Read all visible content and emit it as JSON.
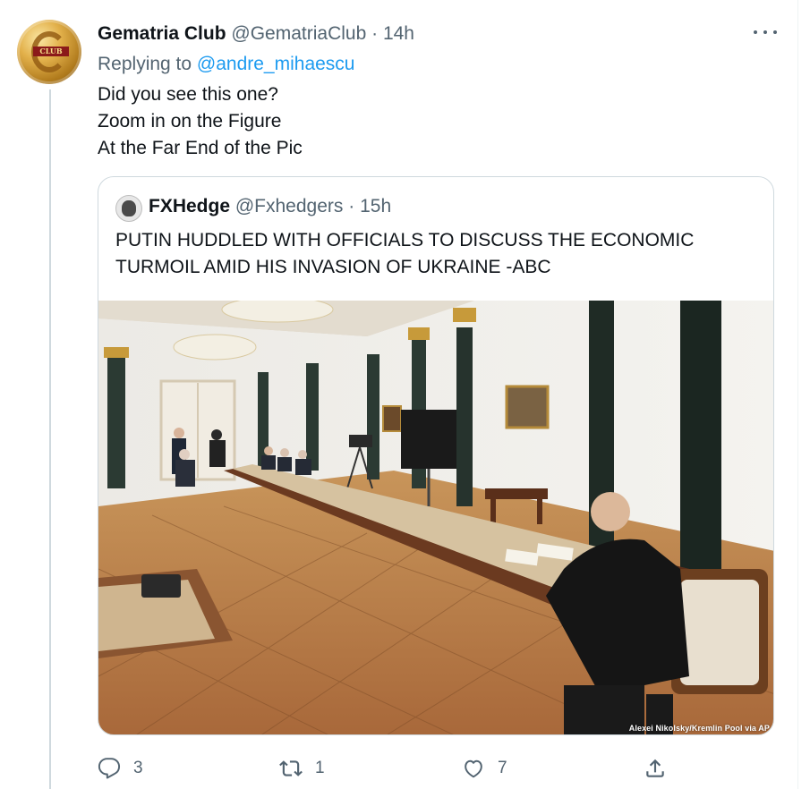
{
  "tweet": {
    "author_name": "Gematria Club",
    "author_handle": "@GematriaClub",
    "separator": "·",
    "time": "14h",
    "avatar_text": "CLUB",
    "replying_prefix": "Replying to",
    "replying_handle": "@andre_mihaescu",
    "lines": [
      "Did you see this one?",
      "Zoom in on the Figure",
      "At the Far End of the Pic"
    ]
  },
  "quoted": {
    "author_name": "FXHedge",
    "author_handle": "@Fxhedgers",
    "separator": "·",
    "time": "15h",
    "lines": [
      "PUTIN HUDDLED WITH OFFICIALS TO DISCUSS THE ECONOMIC",
      "TURMOIL AMID HIS INVASION OF UKRAINE -ABC"
    ],
    "photo_credit": "Alexei Nikolsky/Kremlin Pool via AP"
  },
  "actions": {
    "reply_count": "3",
    "retweet_count": "1",
    "like_count": "7",
    "reply_icon": "reply-icon",
    "retweet_icon": "retweet-icon",
    "like_icon": "like-icon",
    "share_icon": "share-icon"
  },
  "colors": {
    "link": "#1d9bf0",
    "muted": "#536471",
    "text": "#0f1419",
    "border": "#cfd9de"
  }
}
